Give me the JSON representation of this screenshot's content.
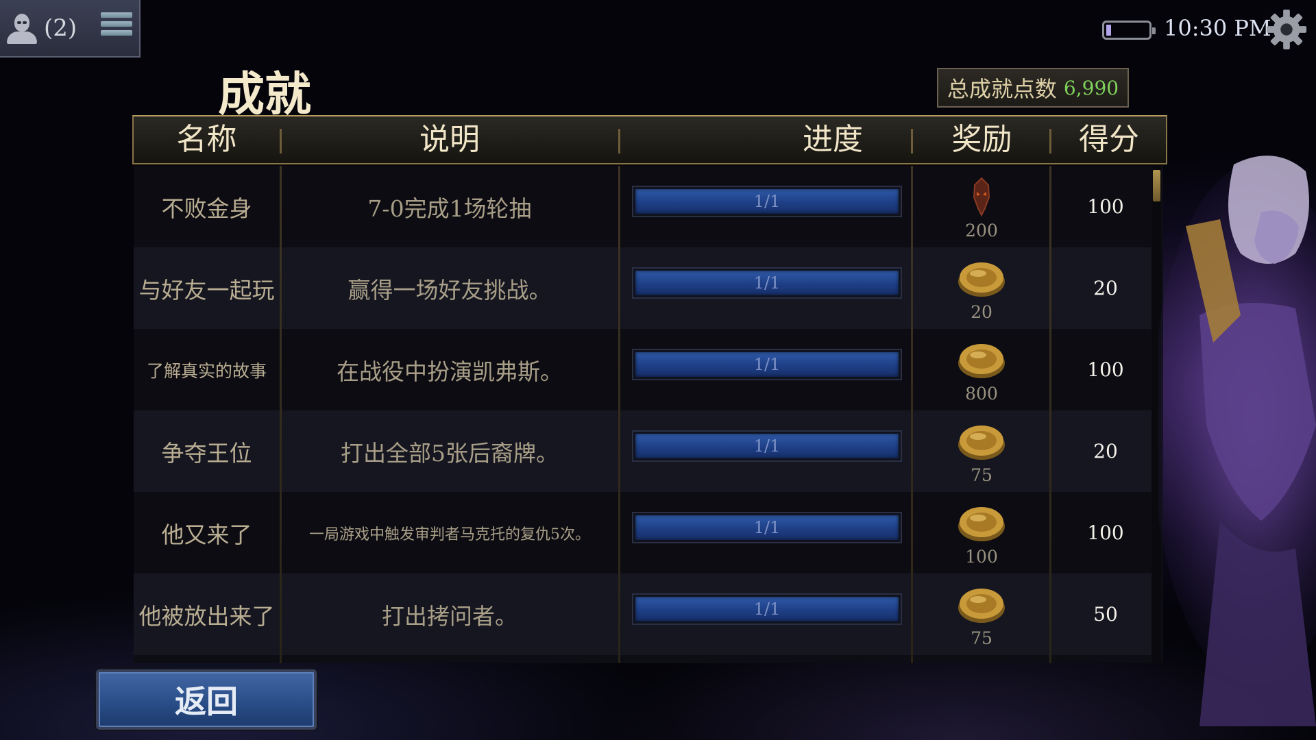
{
  "top_left": {
    "friend_count": "(2)"
  },
  "status_bar": {
    "time": "10:30 PM",
    "battery_level": 0.12
  },
  "page": {
    "title": "成就"
  },
  "total_points": {
    "label": "总成就点数",
    "value": "6,990"
  },
  "table": {
    "columns": [
      "名称",
      "说明",
      "进度",
      "奖励",
      "得分"
    ],
    "rows": [
      {
        "name": "不败金身",
        "description": "7-0完成1场轮抽",
        "progress": "1/1",
        "progress_fraction": 1.0,
        "reward_icon": "mask-icon",
        "reward": "200",
        "score": "100"
      },
      {
        "name": "与好友一起玩",
        "description": "赢得一场好友挑战。",
        "progress": "1/1",
        "progress_fraction": 1.0,
        "reward_icon": "gold-coin-icon",
        "reward": "20",
        "score": "20"
      },
      {
        "name": "了解真实的故事",
        "description": "在战役中扮演凯弗斯。",
        "progress": "1/1",
        "progress_fraction": 1.0,
        "reward_icon": "gold-coin-icon",
        "reward": "800",
        "score": "100"
      },
      {
        "name": "争夺王位",
        "description": "打出全部5张后裔牌。",
        "progress": "1/1",
        "progress_fraction": 1.0,
        "reward_icon": "gold-coin-icon",
        "reward": "75",
        "score": "20"
      },
      {
        "name": "他又来了",
        "description": "一局游戏中触发审判者马克托的复仇5次。",
        "progress": "1/1",
        "progress_fraction": 1.0,
        "reward_icon": "gold-coin-icon",
        "reward": "100",
        "score": "100"
      },
      {
        "name": "他被放出来了",
        "description": "打出拷问者。",
        "progress": "1/1",
        "progress_fraction": 1.0,
        "reward_icon": "gold-coin-icon",
        "reward": "75",
        "score": "50"
      }
    ]
  },
  "back_button": {
    "label": "返回"
  },
  "colors": {
    "gold_text": "#f2e6c8",
    "progress_blue": "#2f5aa8",
    "points_green": "#7fd25a"
  }
}
